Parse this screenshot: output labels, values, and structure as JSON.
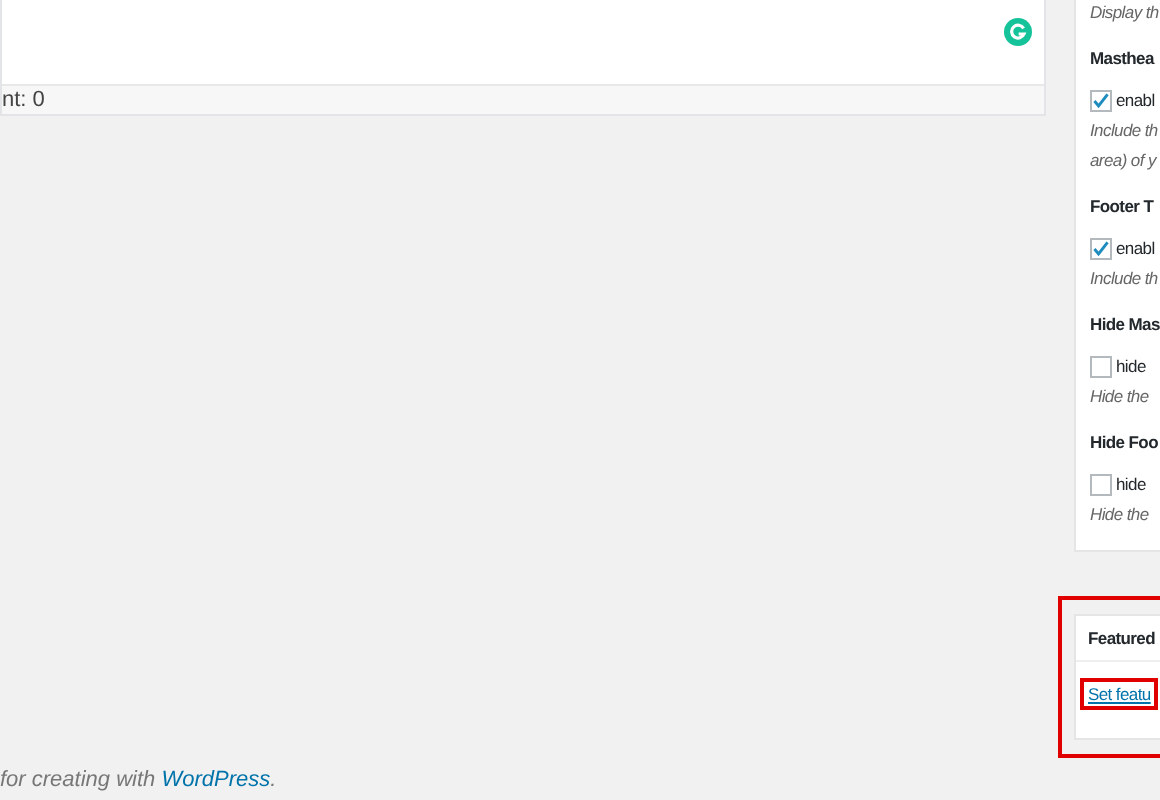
{
  "editor": {
    "status": "nt: 0"
  },
  "sidebar": {
    "items": [
      {
        "kind": "note",
        "text": "Display th"
      },
      {
        "kind": "heading",
        "text": "Masthea"
      },
      {
        "kind": "checkbox",
        "label": "enabl",
        "checked": true
      },
      {
        "kind": "note",
        "text": "Include th"
      },
      {
        "kind": "note",
        "text": "area) of y"
      },
      {
        "kind": "heading",
        "text": "Footer T"
      },
      {
        "kind": "checkbox",
        "label": "enabl",
        "checked": true
      },
      {
        "kind": "note",
        "text": "Include th"
      },
      {
        "kind": "heading",
        "text": "Hide Mas"
      },
      {
        "kind": "checkbox",
        "label": "hide",
        "checked": false
      },
      {
        "kind": "note",
        "text": "Hide the"
      },
      {
        "kind": "heading",
        "text": "Hide Foo"
      },
      {
        "kind": "checkbox",
        "label": "hide",
        "checked": false
      },
      {
        "kind": "note",
        "text": "Hide the"
      }
    ]
  },
  "featured": {
    "title": "Featured",
    "link": "Set featu",
    "highlighted": true
  },
  "footer": {
    "text": "for creating with ",
    "link": "WordPress",
    "end": "."
  }
}
